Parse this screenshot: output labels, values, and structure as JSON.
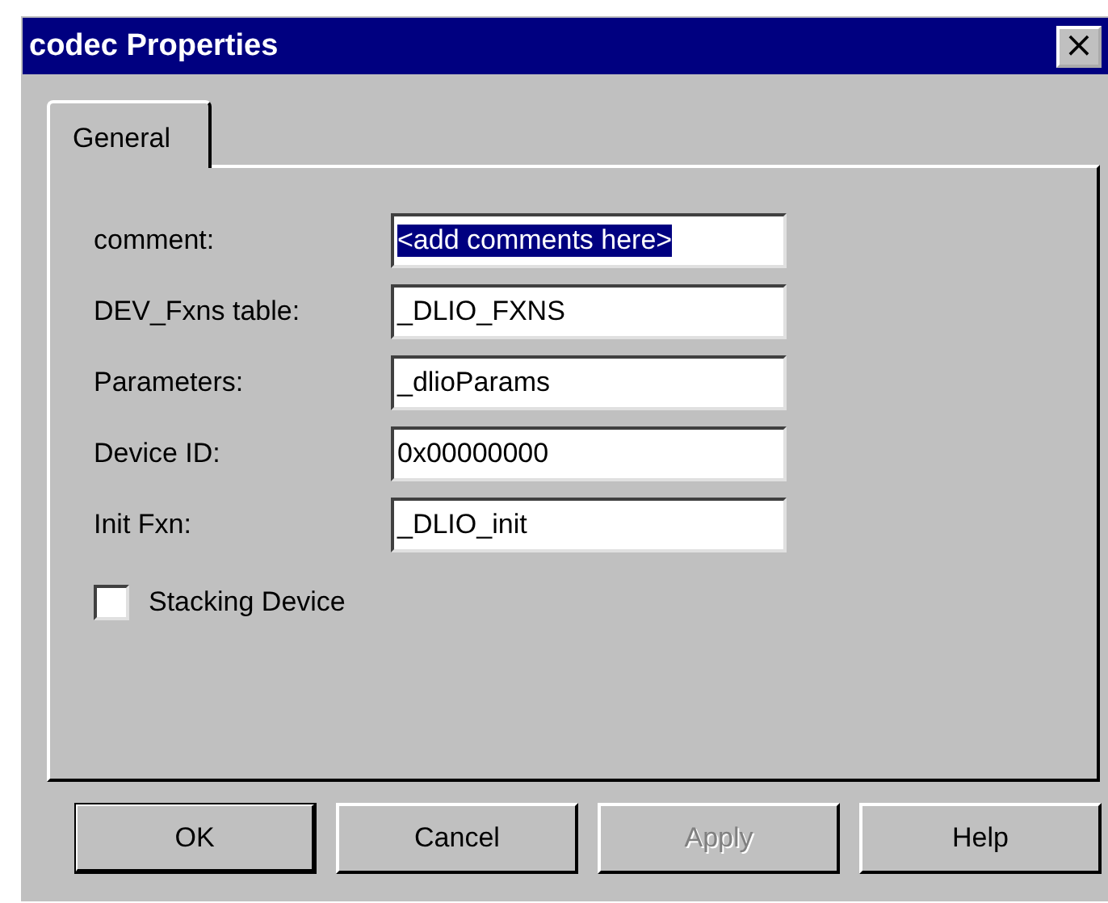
{
  "window": {
    "title": "codec Properties",
    "close": "×"
  },
  "tabs": [
    {
      "label": "General",
      "selected": true
    }
  ],
  "fields": [
    {
      "label": "comment:",
      "value": "<add comments here>",
      "selected": true
    },
    {
      "label": "DEV_Fxns table:",
      "value": "_DLIO_FXNS",
      "selected": false
    },
    {
      "label": "Parameters:",
      "value": "_dlioParams",
      "selected": false
    },
    {
      "label": "Device ID:",
      "value": "0x00000000",
      "selected": false
    },
    {
      "label": "Init Fxn:",
      "value": "_DLIO_init",
      "selected": false
    }
  ],
  "checkbox": {
    "label": "Stacking Device",
    "checked": false
  },
  "buttons": [
    {
      "label": "OK",
      "default": true,
      "disabled": false
    },
    {
      "label": "Cancel",
      "default": false,
      "disabled": false
    },
    {
      "label": "Apply",
      "default": false,
      "disabled": true
    },
    {
      "label": "Help",
      "default": false,
      "disabled": false
    }
  ]
}
